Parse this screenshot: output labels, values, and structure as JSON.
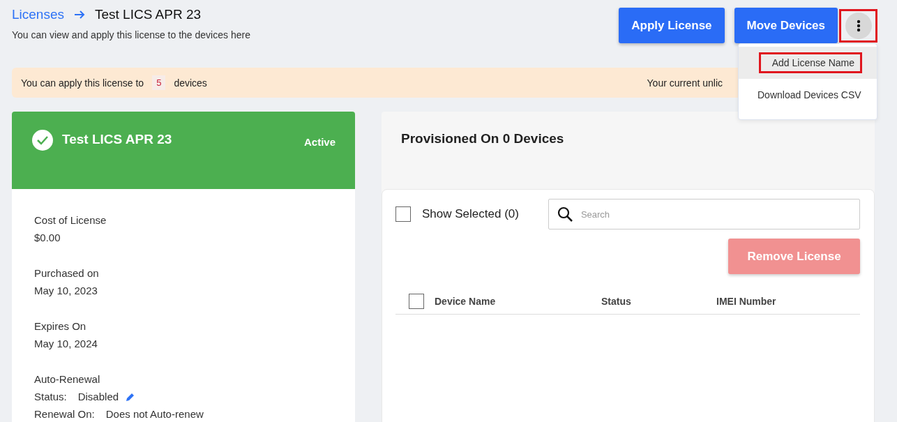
{
  "breadcrumb": {
    "parent": "Licenses",
    "current": "Test LICS APR 23"
  },
  "subtitle": "You can view and apply this license to the devices here",
  "actions": [
    {
      "label": "Apply License"
    },
    {
      "label": "Move Devices"
    }
  ],
  "more_menu": {
    "highlighted": true,
    "expanded": true,
    "items": [
      {
        "label": "Add License Name",
        "selected": true,
        "highlighted": true
      },
      {
        "label": "Download Devices CSV",
        "selected": false,
        "highlighted": false
      }
    ]
  },
  "banner": {
    "prefix": "You can apply this license to",
    "count": "5",
    "suffix": "devices",
    "right_text": "Your current unlic"
  },
  "license_card": {
    "name": "Test LICS APR 23",
    "status": "Active",
    "fields": [
      {
        "label": "Cost of License",
        "value": "$0.00"
      },
      {
        "label": "Purchased on",
        "value": "May 10, 2023"
      },
      {
        "label": "Expires On",
        "value": "May 10, 2024"
      }
    ],
    "auto_renewal": {
      "title": "Auto-Renewal",
      "status_label": "Status:",
      "status_value": "Disabled",
      "renewal_label": "Renewal On:",
      "renewal_value": "Does not Auto-renew"
    }
  },
  "devices_panel": {
    "title": "Provisioned On 0 Devices",
    "show_selected": {
      "label": "Show Selected (0)",
      "checked": false
    },
    "search": {
      "placeholder": "Search"
    },
    "remove_button": {
      "label": "Remove License",
      "disabled": true
    },
    "table": {
      "select_all_checked": false,
      "columns": [
        "Device Name",
        "Status",
        "IMEI Number"
      ]
    }
  }
}
